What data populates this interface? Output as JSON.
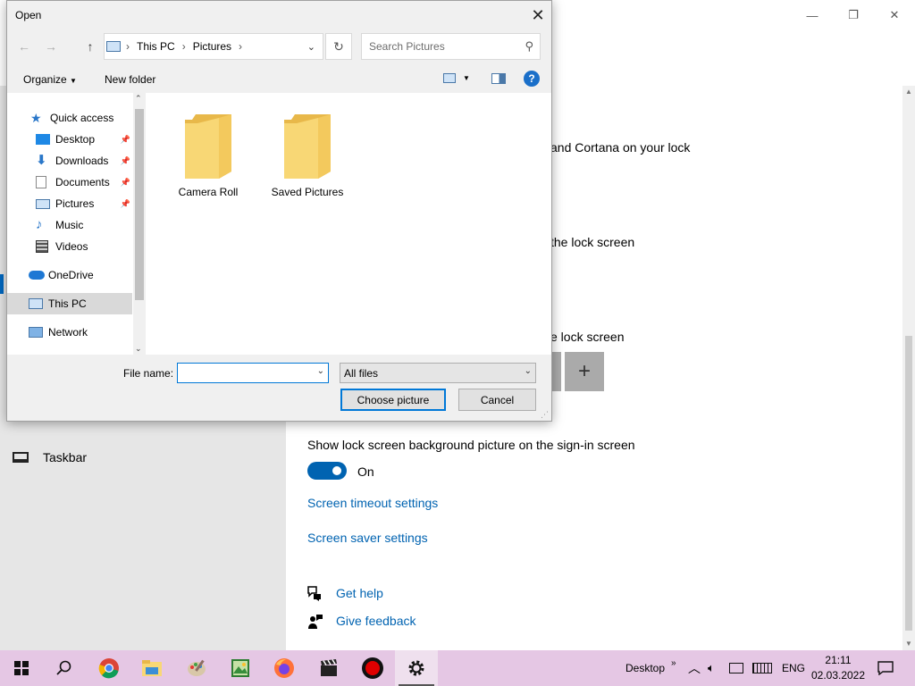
{
  "settings": {
    "window_controls": {
      "minimize": "—",
      "restore": "❐",
      "close": "✕"
    },
    "partial_texts": [
      "and Cortana on your lock",
      "the lock screen",
      "e lock screen"
    ],
    "plus_tile": "+",
    "nav_taskbar_label": "Taskbar",
    "sign_in_label": "Show lock screen background picture on the sign-in screen",
    "toggle_state": "On",
    "links": {
      "screen_timeout": "Screen timeout settings",
      "screen_saver": "Screen saver settings",
      "get_help": "Get help",
      "give_feedback": "Give feedback"
    }
  },
  "dialog": {
    "title": "Open",
    "address": {
      "segments": [
        "This PC",
        "Pictures"
      ]
    },
    "search_placeholder": "Search Pictures",
    "toolbar": {
      "organize": "Organize",
      "new_folder": "New folder",
      "help": "?"
    },
    "nav": [
      {
        "label": "Quick access",
        "icon": "star-icon",
        "pinned": false
      },
      {
        "label": "Desktop",
        "icon": "desktop-icon",
        "pinned": true
      },
      {
        "label": "Downloads",
        "icon": "download-icon",
        "pinned": true
      },
      {
        "label": "Documents",
        "icon": "document-icon",
        "pinned": true
      },
      {
        "label": "Pictures",
        "icon": "pictures-icon",
        "pinned": true
      },
      {
        "label": "Music",
        "icon": "music-icon",
        "pinned": false
      },
      {
        "label": "Videos",
        "icon": "video-icon",
        "pinned": false
      },
      {
        "label": "OneDrive",
        "icon": "cloud-icon",
        "pinned": false
      },
      {
        "label": "This PC",
        "icon": "computer-icon",
        "pinned": false,
        "selected": true
      },
      {
        "label": "Network",
        "icon": "network-icon",
        "pinned": false
      }
    ],
    "folders": [
      "Camera Roll",
      "Saved Pictures"
    ],
    "filename_label": "File name:",
    "filename_value": "",
    "filter": "All files",
    "choose_button": "Choose picture",
    "cancel_button": "Cancel"
  },
  "taskbar": {
    "apps": [
      "start-icon",
      "search-icon",
      "chrome-icon",
      "file-explorer-icon",
      "paint-icon",
      "photos-icon",
      "firefox-icon",
      "video-editor-icon",
      "recorder-icon",
      "settings-icon"
    ],
    "desktop_label": "Desktop",
    "language": "ENG",
    "time": "21:11",
    "date": "02.03.2022"
  },
  "colors": {
    "accent": "#0063b1",
    "taskbar": "#e5c7e4",
    "folder": "#f8d775"
  }
}
